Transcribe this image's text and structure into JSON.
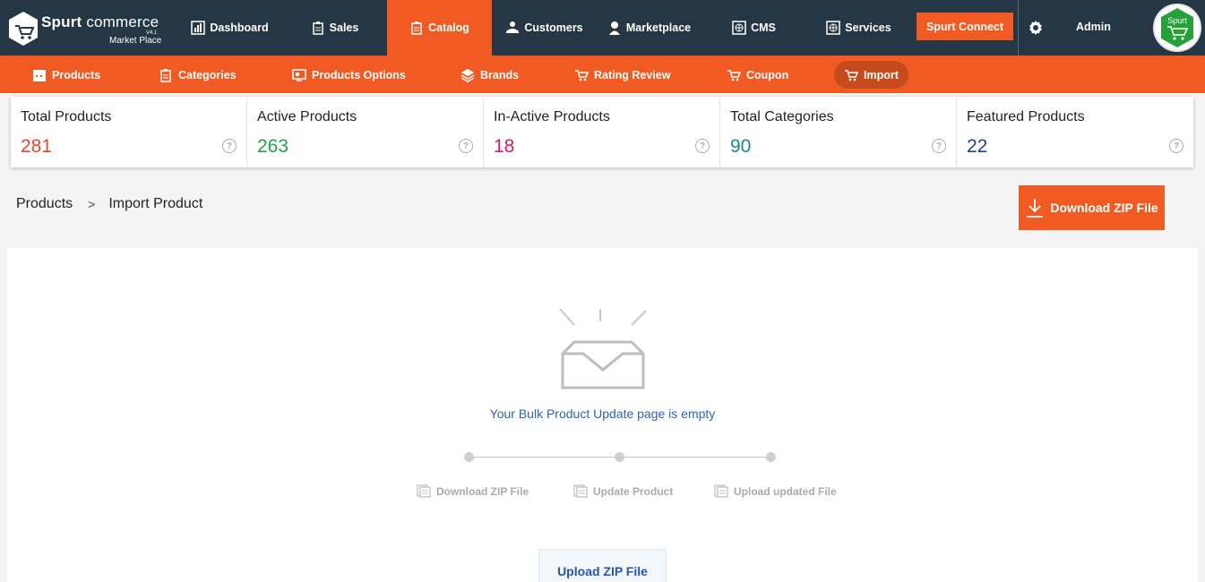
{
  "brand": {
    "title_bold": "Spurt",
    "title_rest": "commerce",
    "version": "V4.1",
    "subtitle": "Market Place"
  },
  "nav": {
    "items": [
      {
        "label": "Dashboard",
        "icon": "chart-icon"
      },
      {
        "label": "Sales",
        "icon": "clipboard-icon"
      },
      {
        "label": "Catalog",
        "icon": "clipboard-icon",
        "active": true
      },
      {
        "label": "Customers",
        "icon": "customers-icon"
      },
      {
        "label": "Marketplace",
        "icon": "user-icon"
      },
      {
        "label": "CMS",
        "icon": "globe-icon"
      },
      {
        "label": "Services",
        "icon": "globe-icon"
      }
    ],
    "spurt_connect": "Spurt Connect",
    "admin": "Admin",
    "avatar_text": "Spurt"
  },
  "subnav": {
    "items": [
      {
        "label": "Products",
        "icon": "calendar-icon"
      },
      {
        "label": "Categories",
        "icon": "clipboard-icon"
      },
      {
        "label": "Products Options",
        "icon": "monitor-icon"
      },
      {
        "label": "Brands",
        "icon": "layers-icon"
      },
      {
        "label": "Rating Review",
        "icon": "cart-icon"
      },
      {
        "label": "Coupon",
        "icon": "cart-icon"
      },
      {
        "label": "Import",
        "icon": "cart-icon",
        "active": true
      }
    ]
  },
  "stats": [
    {
      "label": "Total Products",
      "value": "281",
      "color": "#e8472a"
    },
    {
      "label": "Active Products",
      "value": "263",
      "color": "#1ea34a"
    },
    {
      "label": "In-Active Products",
      "value": "18",
      "color": "#d81b5a"
    },
    {
      "label": "Total Categories",
      "value": "90",
      "color": "#1a8a8a"
    },
    {
      "label": "Featured Products",
      "value": "22",
      "color": "#233f8f"
    }
  ],
  "breadcrumb": {
    "root": "Products",
    "sep": ">",
    "current": "Import Product"
  },
  "download_zip_label": "Download ZIP File",
  "empty": {
    "message": "Your Bulk Product Update page is empty"
  },
  "steps": [
    {
      "label": "Download ZIP File"
    },
    {
      "label": "Update Product"
    },
    {
      "label": "Upload updated File"
    }
  ],
  "upload_zip_label": "Upload ZIP File",
  "colors": {
    "accent": "#f15a22",
    "nav_bg": "#253645",
    "link_blue": "#2f62b5"
  }
}
